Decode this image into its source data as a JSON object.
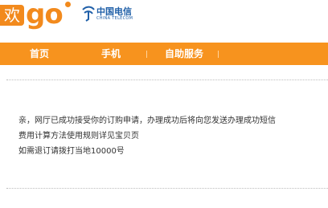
{
  "brand": {
    "logo_char": "欢",
    "logo_go": "go",
    "partner_name_cn": "中国电信",
    "partner_name_en": "CHINA TELECOM"
  },
  "nav": {
    "items": [
      {
        "label": "首页"
      },
      {
        "label": "手机"
      },
      {
        "label": "自助服务"
      }
    ]
  },
  "message": {
    "lines": [
      "亲，网厅已成功接受你的订购申请，办理成功后将向您发送办理成功短信",
      "费用计算方法使用规则详见宝贝页",
      "如需退订请拨打当地10000号"
    ]
  },
  "colors": {
    "accent": "#f7931e",
    "brand_blue": "#1f5fa8"
  }
}
